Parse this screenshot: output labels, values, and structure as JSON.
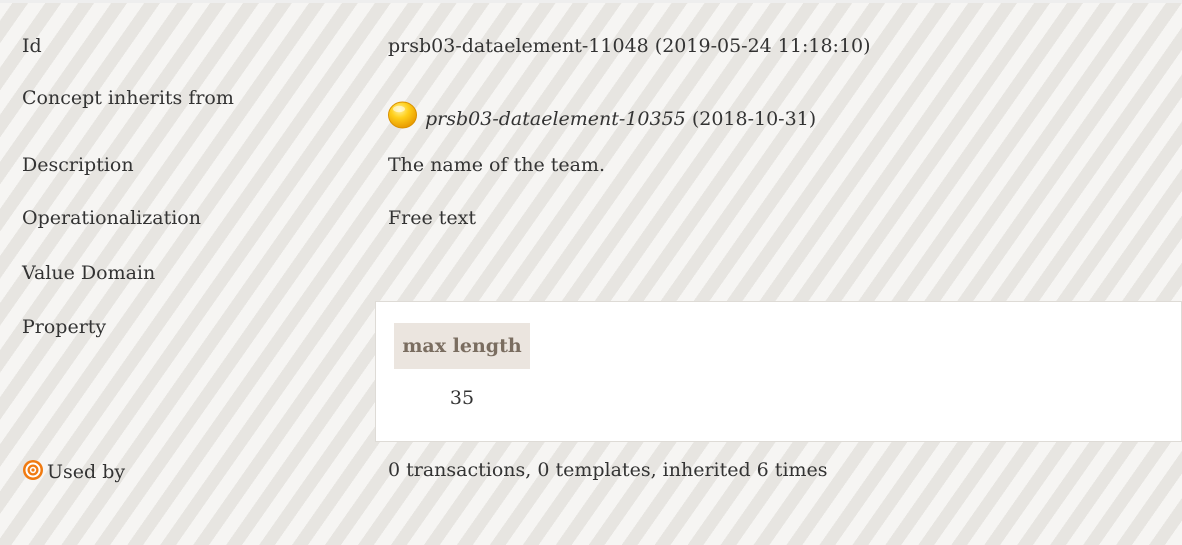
{
  "concept": {
    "id": {
      "label": "Id",
      "value": "prsb03-dataelement-11048 (2019-05-24 11:18:10)"
    },
    "inherits": {
      "label": "Concept inherits from",
      "icon": "status-sun-icon",
      "ref_id": "prsb03-dataelement-10355",
      "ref_date": " (2018-10-31)"
    },
    "description": {
      "label": "Description",
      "value": "The name of the team."
    },
    "operationalization": {
      "label": "Operationalization",
      "value": "Free text"
    },
    "value_domain": {
      "label": "Value Domain",
      "value": ""
    },
    "property": {
      "label": "Property",
      "header": "max length",
      "value": "35"
    },
    "used_by": {
      "icon": "target-icon",
      "label": "Used by",
      "value": "0 transactions, 0 templates, inherited 6 times"
    }
  },
  "colors": {
    "stripe_light": "#f6f5f3",
    "stripe_dark": "#e7e5e1",
    "header_bg": "#ebe5df",
    "header_text": "#7a6d60",
    "icon_sun": "#f5b800",
    "icon_target": "#f07a10"
  }
}
